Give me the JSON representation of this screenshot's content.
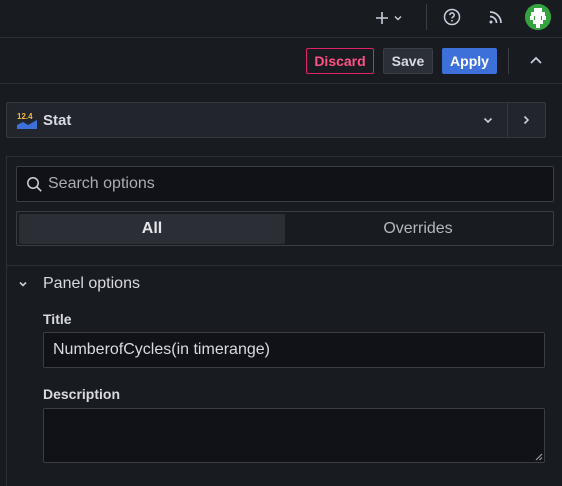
{
  "topbar": {
    "add_icon": "plus-icon",
    "help_icon": "help-circle-icon",
    "news_icon": "rss-icon",
    "avatar_icon": "user-avatar"
  },
  "actions": {
    "discard_label": "Discard",
    "save_label": "Save",
    "apply_label": "Apply",
    "collapse_icon": "chevron-up-icon"
  },
  "visualization": {
    "name": "Stat",
    "icon_text": "12.4"
  },
  "options": {
    "search_placeholder": "Search options",
    "tabs": [
      {
        "label": "All",
        "active": true
      },
      {
        "label": "Overrides",
        "active": false
      }
    ]
  },
  "panel_options": {
    "section_title": "Panel options",
    "title_label": "Title",
    "title_value": "NumberofCycles(in timerange)",
    "description_label": "Description",
    "description_value": ""
  },
  "colors": {
    "apply": "#3d71d9",
    "discard": "#ff5286",
    "background": "#181b1f"
  }
}
